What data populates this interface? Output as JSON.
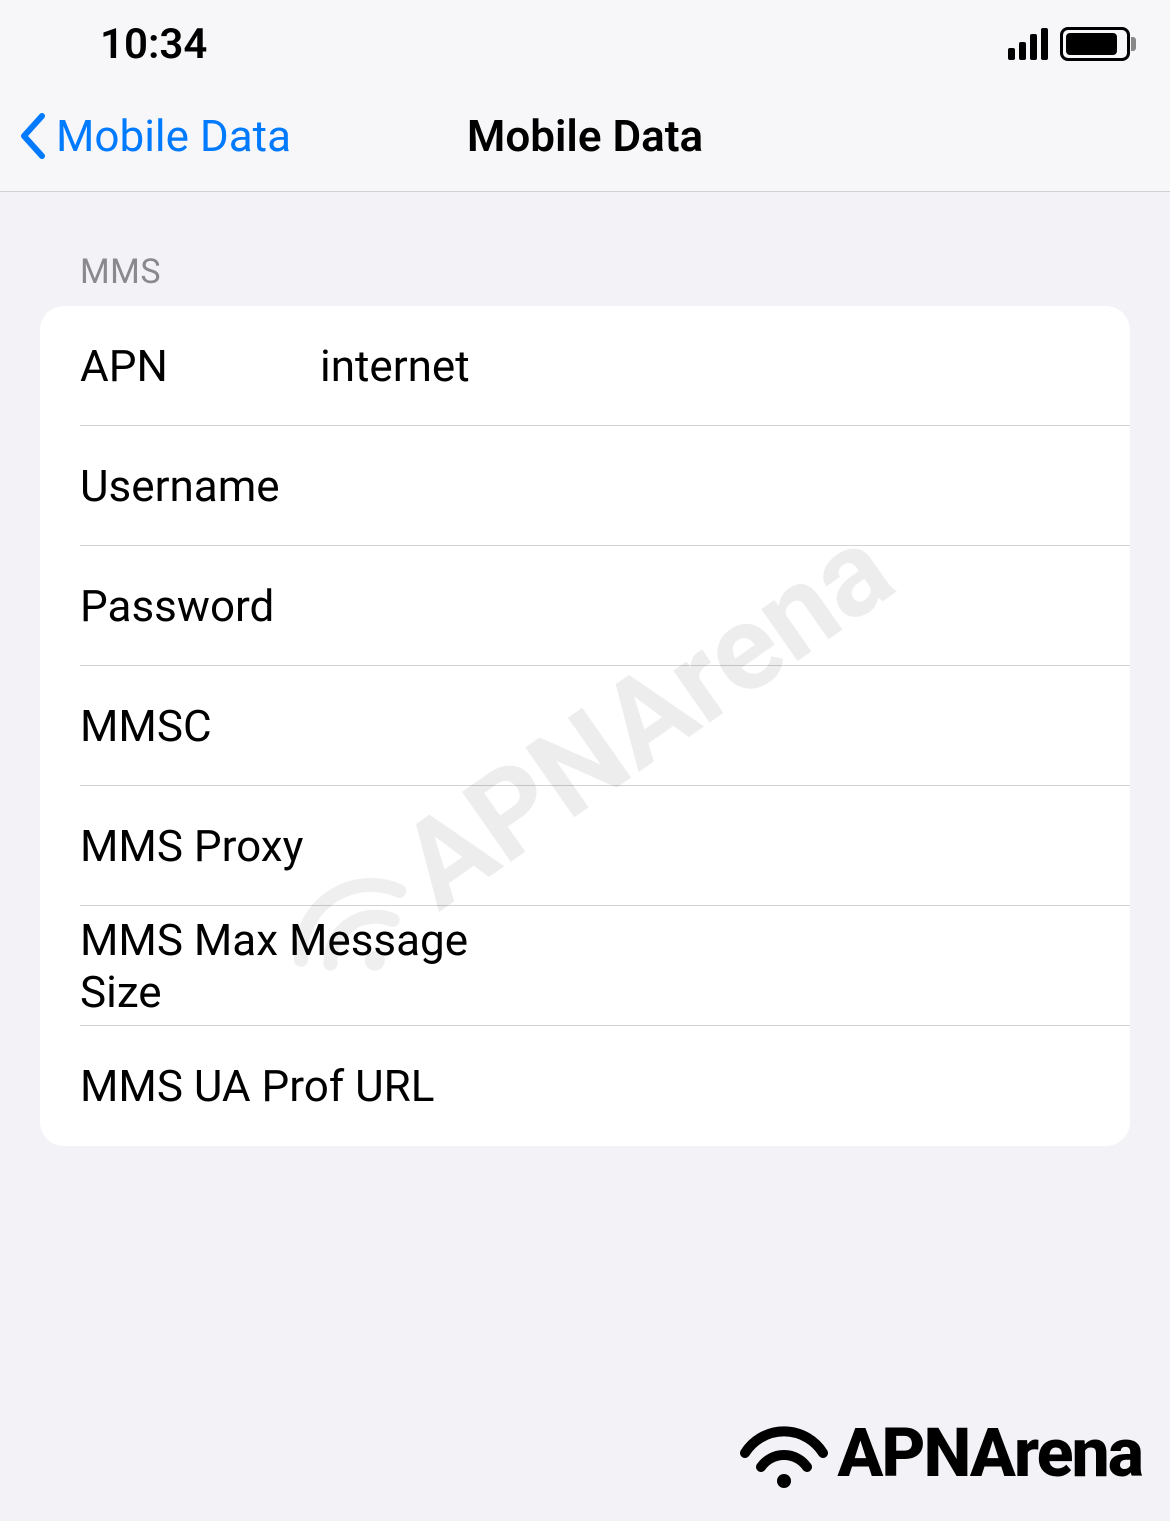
{
  "statusBar": {
    "time": "10:34"
  },
  "nav": {
    "backLabel": "Mobile Data",
    "title": "Mobile Data"
  },
  "section": {
    "header": "MMS",
    "rows": [
      {
        "label": "APN",
        "value": "internet"
      },
      {
        "label": "Username",
        "value": ""
      },
      {
        "label": "Password",
        "value": ""
      },
      {
        "label": "MMSC",
        "value": ""
      },
      {
        "label": "MMS Proxy",
        "value": ""
      },
      {
        "label": "MMS Max Message Size",
        "value": ""
      },
      {
        "label": "MMS UA Prof URL",
        "value": ""
      }
    ]
  },
  "watermark": "APNArena",
  "footerLogo": "APNArena"
}
